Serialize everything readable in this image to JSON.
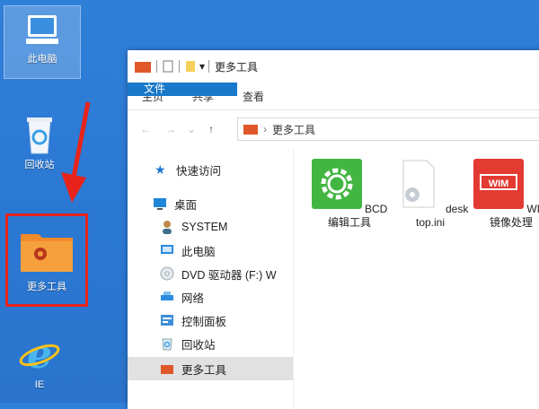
{
  "desktop": {
    "computer_label": "此电脑",
    "recycle_label": "回收站",
    "tools_label": "更多工具",
    "ie_label": "IE"
  },
  "window": {
    "title": "更多工具",
    "ribbon_tabs": [
      "文件",
      "主页",
      "共享",
      "查看"
    ],
    "address": "更多工具",
    "nav": {
      "quick_access": "快速访问",
      "desktop": "桌面",
      "system": "SYSTEM",
      "this_pc": "此电脑",
      "dvd": "DVD 驱动器 (F:) W",
      "network": "网络",
      "control_panel": "控制面板",
      "recycle": "回收站",
      "more_tools": "更多工具"
    },
    "files": [
      {
        "name": "BCD编辑工具",
        "icon": "gear-icon"
      },
      {
        "name": "desktop.ini",
        "icon": "settings-file-icon"
      },
      {
        "name": "WIM镜像处理",
        "icon": "wim-icon",
        "badge": "WIM"
      }
    ]
  },
  "colors": {
    "desktop_bg": "#2b78d3",
    "file_tab": "#1979ca",
    "highlight": "#e8231b"
  }
}
